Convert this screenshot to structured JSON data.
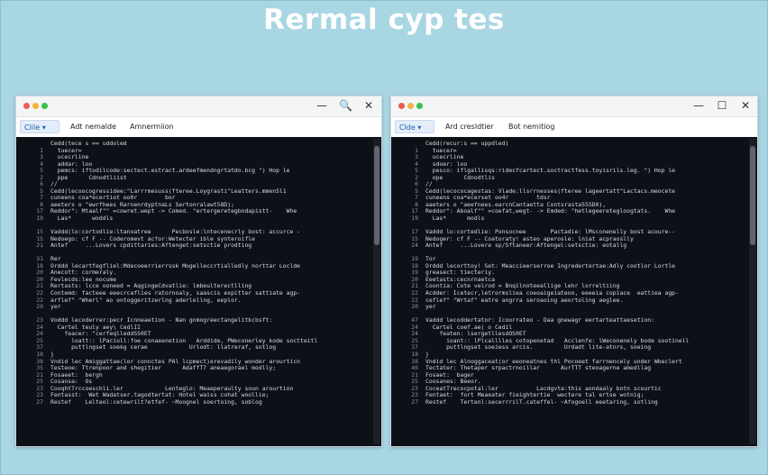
{
  "page": {
    "title": "Rermal cyp tes"
  },
  "windows": [
    {
      "toolbar": {
        "file_label": "Clile ▾",
        "item1": "Adt nemalde",
        "item2": "Amnermiion"
      },
      "controls": [
        "—",
        "🔍",
        "✕"
      ],
      "lines": [
        {
          "n": "",
          "t": "Cedd(tece s == uddoled"
        },
        {
          "n": "1",
          "t": "  tuecer="
        },
        {
          "n": "3",
          "t": "  ucecrline"
        },
        {
          "n": "4",
          "t": "  addar: loo"
        },
        {
          "n": "5",
          "t": "  pemcs: iftodilcode:sectect.estract.ardeefmendngrtatdo.bcg \") Hop le"
        },
        {
          "n": "2",
          "t": "  ppe      Cdnodtliist"
        },
        {
          "n": "6",
          "t": "//"
        },
        {
          "n": "5",
          "t": "Cedd(lecoocogressidee:\"Larrrmesuss(fteree.Loygrasti\"Leatters.mmen5l1"
        },
        {
          "n": "7",
          "t": "cuneens coa*ecertiot oo0r        bor"
        },
        {
          "n": "8",
          "t": "aeeters o \"ewrfhees RarnenrdyptnaLs Sertonralawt58D);"
        },
        {
          "n": "17",
          "t": "Reddor\": Mtaalf\"\" =cowret.wept -> Comed. \"ertergeretegbndapistt-    Whe"
        },
        {
          "n": "19",
          "t": "  Las*      woddls"
        },
        {
          "n": "",
          "t": ""
        },
        {
          "n": "15",
          "t": "Vaddd(lo:cortodlie:ltanoatree      Pecbosle:lntecenecrly bost: accurce -"
        },
        {
          "n": "15",
          "t": "Nedoego: cf F -- Coderomevt acfor:Wetecter ible synteroifle"
        },
        {
          "n": "21",
          "t": "Antef     ...Lovers cpdittaries:Aftenget:setsctie prodting"
        },
        {
          "n": "",
          "t": ""
        },
        {
          "n": "31",
          "t": "Rer"
        },
        {
          "n": "18",
          "t": "Orddd lecartfegfliel:Mdecoeerrierrssk Mogelleccrtialledly norttar Loclde"
        },
        {
          "n": "20",
          "t": "Anecott: cormeraly."
        },
        {
          "n": "20",
          "t": "Fevlecds:lee nocume"
        },
        {
          "n": "21",
          "t": "Rertasts: lcce ooneed = AqgingeCdvatlie: lmbeulterectlling"
        },
        {
          "n": "22",
          "t": "Contemd: facteee eeecrcaflies ratornoaly, saascis expitter sattiate agp-"
        },
        {
          "n": "22",
          "t": "arflef\" \"Wherl\" ao ontoggeritzerlng aderlellng, eeplor."
        },
        {
          "n": "20",
          "t": "yer"
        },
        {
          "n": "",
          "t": ""
        },
        {
          "n": "23",
          "t": "Voddd lecoderrer:pecr Icnneaetion - Nan gnmogreectangelitb(bsft:"
        },
        {
          "n": "24",
          "t": "  Cartel teuly aey\\ CedlII"
        },
        {
          "n": "24",
          "t": "    feacer: \"cerfeqlleddSS0ET"
        },
        {
          "n": "25",
          "t": "      loatt:: lPacioll:foe conaeenetion   Arddide, PWeconerley kode soctteitl"
        },
        {
          "n": "37",
          "t": "      puttlngset soekg cerae            Urlodt: llatreraf, sotlog"
        },
        {
          "n": "18",
          "t": "}"
        },
        {
          "n": "38",
          "t": "Vndid lec Amiggattae(lor connctes PAl lcpmect)erevadily wonder arourticn"
        },
        {
          "n": "35",
          "t": "Testeoe: Ttrenpoor and shegitier      AdaffT7 aneaegorael modlly;"
        },
        {
          "n": "21",
          "t": "Fosaeet:  bergh"
        },
        {
          "n": "25",
          "t": "Cosansa:  Os"
        },
        {
          "n": "23",
          "t": "CooqhtTrccoeschli.ler            Lenteglo: Meaeperaulty soun arourtion"
        },
        {
          "n": "23",
          "t": "Fentasst:  Wet Wadatser.tagodtertat: Hotel waiss cohat woollie;"
        },
        {
          "n": "27",
          "t": "Restef    Lelteol:cetewrilt?etfef- ~Moognel soertoing, soblog"
        }
      ]
    },
    {
      "toolbar": {
        "file_label": "Clde ▾",
        "item1": "Ard cresldtier",
        "item2": "Bot nemitiog"
      },
      "controls": [
        "—",
        "☐",
        "✕"
      ],
      "lines": [
        {
          "n": "",
          "t": "Cedd(recur:s == uppdled)"
        },
        {
          "n": "1",
          "t": "  tuecer="
        },
        {
          "n": "3",
          "t": "  ucecrline"
        },
        {
          "n": "4",
          "t": "  sdoer: loo"
        },
        {
          "n": "5",
          "t": "  pesco: iflgallisqs:ridecfcartect.soctractfess.toyisrils.leg. \") Hop le"
        },
        {
          "n": "2",
          "t": "  ope      Cdnodtlis"
        },
        {
          "n": "6",
          "t": "//"
        },
        {
          "n": "5",
          "t": "Cedd(lecococagestas: Vlade:llsrrnesses(fteree lageertatt\"Lactacs.meocete"
        },
        {
          "n": "7",
          "t": "cuneens coa*ecerset oo4r        tdsr"
        },
        {
          "n": "8",
          "t": "aaeters o \"aeefnees.earcnCantaetta Contsrasta55SD0),"
        },
        {
          "n": "17",
          "t": "Reddor\": Aboalf\"\" =coefat,wegt- -> Emded: \"hetlegeeretegloogtats.    Whe"
        },
        {
          "n": "19",
          "t": "  Las*      modls"
        },
        {
          "n": "",
          "t": ""
        },
        {
          "n": "17",
          "t": "Vaddd lo:cortedlie: Ponsocnee       Pactadie: lMsconenelly bost acoure--"
        },
        {
          "n": "15",
          "t": "Nedoger: cf F -- Coatoraty! asteo aperosle: lniat acpraoslly"
        },
        {
          "n": "24",
          "t": "Antef     ...Lovere sp/Sftaneer:Aftengel:setsctie: eotallg"
        },
        {
          "n": "",
          "t": ""
        },
        {
          "n": "19",
          "t": "Tor"
        },
        {
          "n": "18",
          "t": "Orddd lecorttoy! Set: Meaccieerserroe Ingredertertae:Adly cootlor Lortle"
        },
        {
          "n": "19",
          "t": "greasect: tiecteriy."
        },
        {
          "n": "20",
          "t": "Eeetasts:cecnrnaetca"
        },
        {
          "n": "21",
          "t": "Coontia: Cote velrod = Bnqilnoteeallige lehr lorreltiing"
        },
        {
          "n": "22",
          "t": "Acdder: Icetecr,letrormsliea coeoaigeiateoo, eeeeia copiace  eattiea agp-"
        },
        {
          "n": "22",
          "t": "ceflef\" \"Wrtaf\" eatre angrra seroaoing aeortoling aeglee."
        },
        {
          "n": "20",
          "t": "yer"
        },
        {
          "n": "",
          "t": ""
        },
        {
          "n": "47",
          "t": "Vaddd lecoddertator: Icoorrateo - Daa gnewagr eertarteattaesetion:"
        },
        {
          "n": "24",
          "t": "  Cartel coef.ae( o Cedil"
        },
        {
          "n": "24",
          "t": "    featen: lsergetllesdOS0ET"
        },
        {
          "n": "25",
          "t": "      ioant:: lPlcalllles cotopenetad   Acclenfe: lWeconenely bode sootinell"
        },
        {
          "n": "37",
          "t": "      puttlngset soeiess arcis.         Urdadt lite-atnrs, soeing"
        },
        {
          "n": "18",
          "t": "}"
        },
        {
          "n": "38",
          "t": "Vndid lec Alnoggaceat(or eeoneatnes thl Pocoeet farrnencely under Wbeclert"
        },
        {
          "n": "46",
          "t": "Tectater: Thetaper srpactrnoillar      AurTTT steoagerne amedllag"
        },
        {
          "n": "21",
          "t": "Fosaet:  bager"
        },
        {
          "n": "25",
          "t": "Coosanes: Beeor."
        },
        {
          "n": "23",
          "t": "CoceatTrecocpotal:ler           Lacdgvta:this aondaaly botn scourtic"
        },
        {
          "n": "23",
          "t": "Fentaet:  fort Meaeater fieightertie  wectere tal ertse wotnig;"
        },
        {
          "n": "27",
          "t": "Restef    Tertenl:secerrrilT.cateffel- ~Afogoell eeetaring, sotling"
        }
      ]
    }
  ]
}
